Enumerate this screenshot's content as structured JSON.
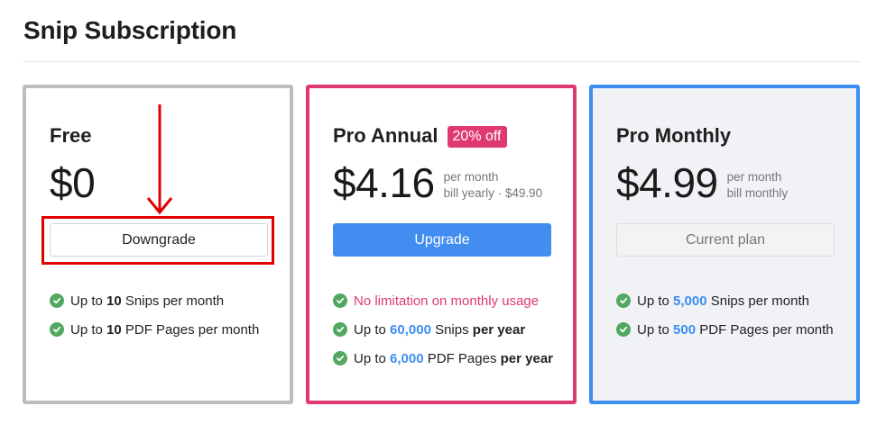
{
  "page_title": "Snip Subscription",
  "colors": {
    "free_border": "#bdbdbd",
    "annual_border": "#e0396f",
    "monthly_border": "#3d8ef1",
    "upgrade_button": "#418df0",
    "check": "#52a860",
    "annotation": "#e00000"
  },
  "plans": {
    "free": {
      "name": "Free",
      "price": "$0",
      "button": "Downgrade",
      "features": [
        {
          "pre": "Up to ",
          "value": "10",
          "post": " Snips per month"
        },
        {
          "pre": "Up to ",
          "value": "10",
          "post": " PDF Pages per month"
        }
      ]
    },
    "annual": {
      "name": "Pro Annual",
      "badge": "20% off",
      "price": "$4.16",
      "note_line1": "per month",
      "note_line2": "bill yearly · $49.90",
      "button": "Upgrade",
      "features": [
        {
          "text": "No limitation on monthly usage"
        },
        {
          "pre": "Up to ",
          "value": "60,000",
          "post": " Snips ",
          "bold": "per year"
        },
        {
          "pre": "Up to ",
          "value": "6,000",
          "post": " PDF Pages ",
          "bold": "per year"
        }
      ]
    },
    "monthly": {
      "name": "Pro Monthly",
      "price": "$4.99",
      "note_line1": "per month",
      "note_line2": "bill monthly",
      "button": "Current plan",
      "features": [
        {
          "pre": "Up to ",
          "value": "5,000",
          "post": " Snips per month"
        },
        {
          "pre": "Up to ",
          "value": "500",
          "post": " PDF Pages per month"
        }
      ]
    }
  },
  "icons": {
    "check": "check-circle-icon",
    "annotation": "down-arrow-icon"
  }
}
